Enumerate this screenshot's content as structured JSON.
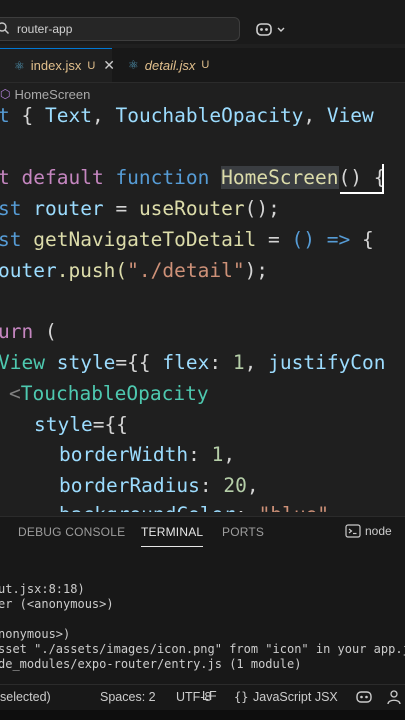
{
  "search": {
    "text": "router-app"
  },
  "tabs": [
    {
      "label": "index.jsx",
      "status": "U",
      "active": true
    },
    {
      "label": "detail.jsx",
      "status": "U",
      "active": false
    }
  ],
  "breadcrumb": {
    "label": "HomeScreen"
  },
  "code": {
    "l1": [
      "t",
      "{",
      "Text",
      ",",
      "TouchableOpacity",
      ",",
      "View"
    ],
    "l2": [
      "t",
      "default",
      "function",
      "HomeScreen",
      "()",
      "{"
    ],
    "l3": [
      "st",
      "router",
      "=",
      "useRouter",
      "();"
    ],
    "l4": [
      "st",
      "getNavigateToDetail",
      "=",
      "() =>",
      "{"
    ],
    "l5": [
      "outer",
      ".push(",
      "\"./detail\"",
      ");"
    ],
    "l6": [
      "urn",
      "("
    ],
    "l7": [
      "View",
      "style",
      "={{",
      "flex",
      ":",
      "1",
      ",",
      "justifyCon"
    ],
    "l8": [
      "<",
      "TouchableOpacity"
    ],
    "l9": [
      "style",
      "={{"
    ],
    "l10": [
      "borderWidth",
      ":",
      "1",
      ","
    ],
    "l11": [
      "borderRadius",
      ":",
      "20",
      ","
    ],
    "l12": [
      "backgroundColor",
      ":",
      "\"blue\""
    ]
  },
  "panel": {
    "tabs": [
      "DEBUG CONSOLE",
      "TERMINAL",
      "PORTS"
    ],
    "active_tab": "TERMINAL",
    "shell": "node",
    "lines": [
      "ut.jsx:8:18)",
      "er (<anonymous>)",
      "",
      "nonymous>)",
      "sset \"./assets/images/icon.png\" from \"icon\" in your app.js",
      "de_modules/expo-router/entry.js (1 module)"
    ]
  },
  "status": {
    "selection": "selected)",
    "spaces": "Spaces: 2",
    "encoding": "UTF-8",
    "eol": "LF",
    "language": "JavaScript JSX"
  },
  "colors": {
    "accent": "#0078d4",
    "untracked": "#e2c08d",
    "keyword": "#569cd6",
    "type": "#4ec9b0",
    "string": "#ce9178"
  },
  "icons": [
    "search-icon",
    "copilot-icon",
    "react-file-icon",
    "close-icon",
    "symbol-icon",
    "terminal-icon",
    "braces-icon",
    "copilot-status-icon",
    "accounts-icon"
  ]
}
